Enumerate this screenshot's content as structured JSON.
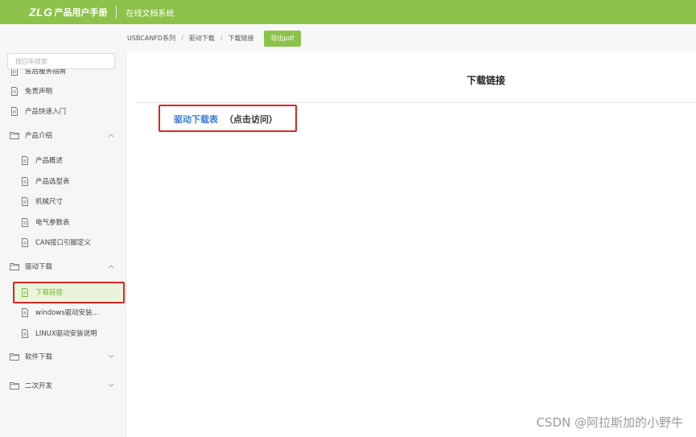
{
  "header": {
    "logo_mark": "ZLG",
    "logo_text": "产品用户手册",
    "system_title": "在线文档系统"
  },
  "breadcrumb": {
    "items": [
      "USBCANFD系列",
      "驱动下载",
      "下载链接"
    ],
    "separator": "/",
    "export_label": "导出pdf"
  },
  "sidebar": {
    "search_placeholder": "按回车搜索",
    "items": [
      {
        "label": "售后服务指南",
        "icon": "doc-icon"
      },
      {
        "label": "免责声明",
        "icon": "doc-icon"
      },
      {
        "label": "产品快速入门",
        "icon": "doc-icon"
      },
      {
        "label": "产品介绍",
        "icon": "folder-icon",
        "expanded": true
      },
      {
        "label": "产品概述",
        "icon": "doc-icon"
      },
      {
        "label": "产品选型表",
        "icon": "doc-icon"
      },
      {
        "label": "机械尺寸",
        "icon": "doc-icon"
      },
      {
        "label": "电气参数表",
        "icon": "doc-icon"
      },
      {
        "label": "CAN接口引脚定义",
        "icon": "doc-icon"
      },
      {
        "label": "驱动下载",
        "icon": "folder-icon",
        "expanded": true
      },
      {
        "label": "下载链接",
        "icon": "doc-icon",
        "active": true
      },
      {
        "label": "windows驱动安装...",
        "icon": "doc-icon"
      },
      {
        "label": "LINUX驱动安装说明",
        "icon": "doc-icon"
      },
      {
        "label": "软件下载",
        "icon": "folder-icon",
        "expanded": false
      },
      {
        "label": "二次开发",
        "icon": "folder-icon",
        "expanded": false
      }
    ]
  },
  "main": {
    "title": "下载链接",
    "link_label": "驱动下载表",
    "link_note": "（点击访问）"
  },
  "watermark": "CSDN @阿拉斯加的小野牛",
  "colors": {
    "brand_green": "#8cc24a",
    "link_blue": "#3a7bd5",
    "highlight_red": "#e02424",
    "active_bg": "#eaf4dc"
  }
}
